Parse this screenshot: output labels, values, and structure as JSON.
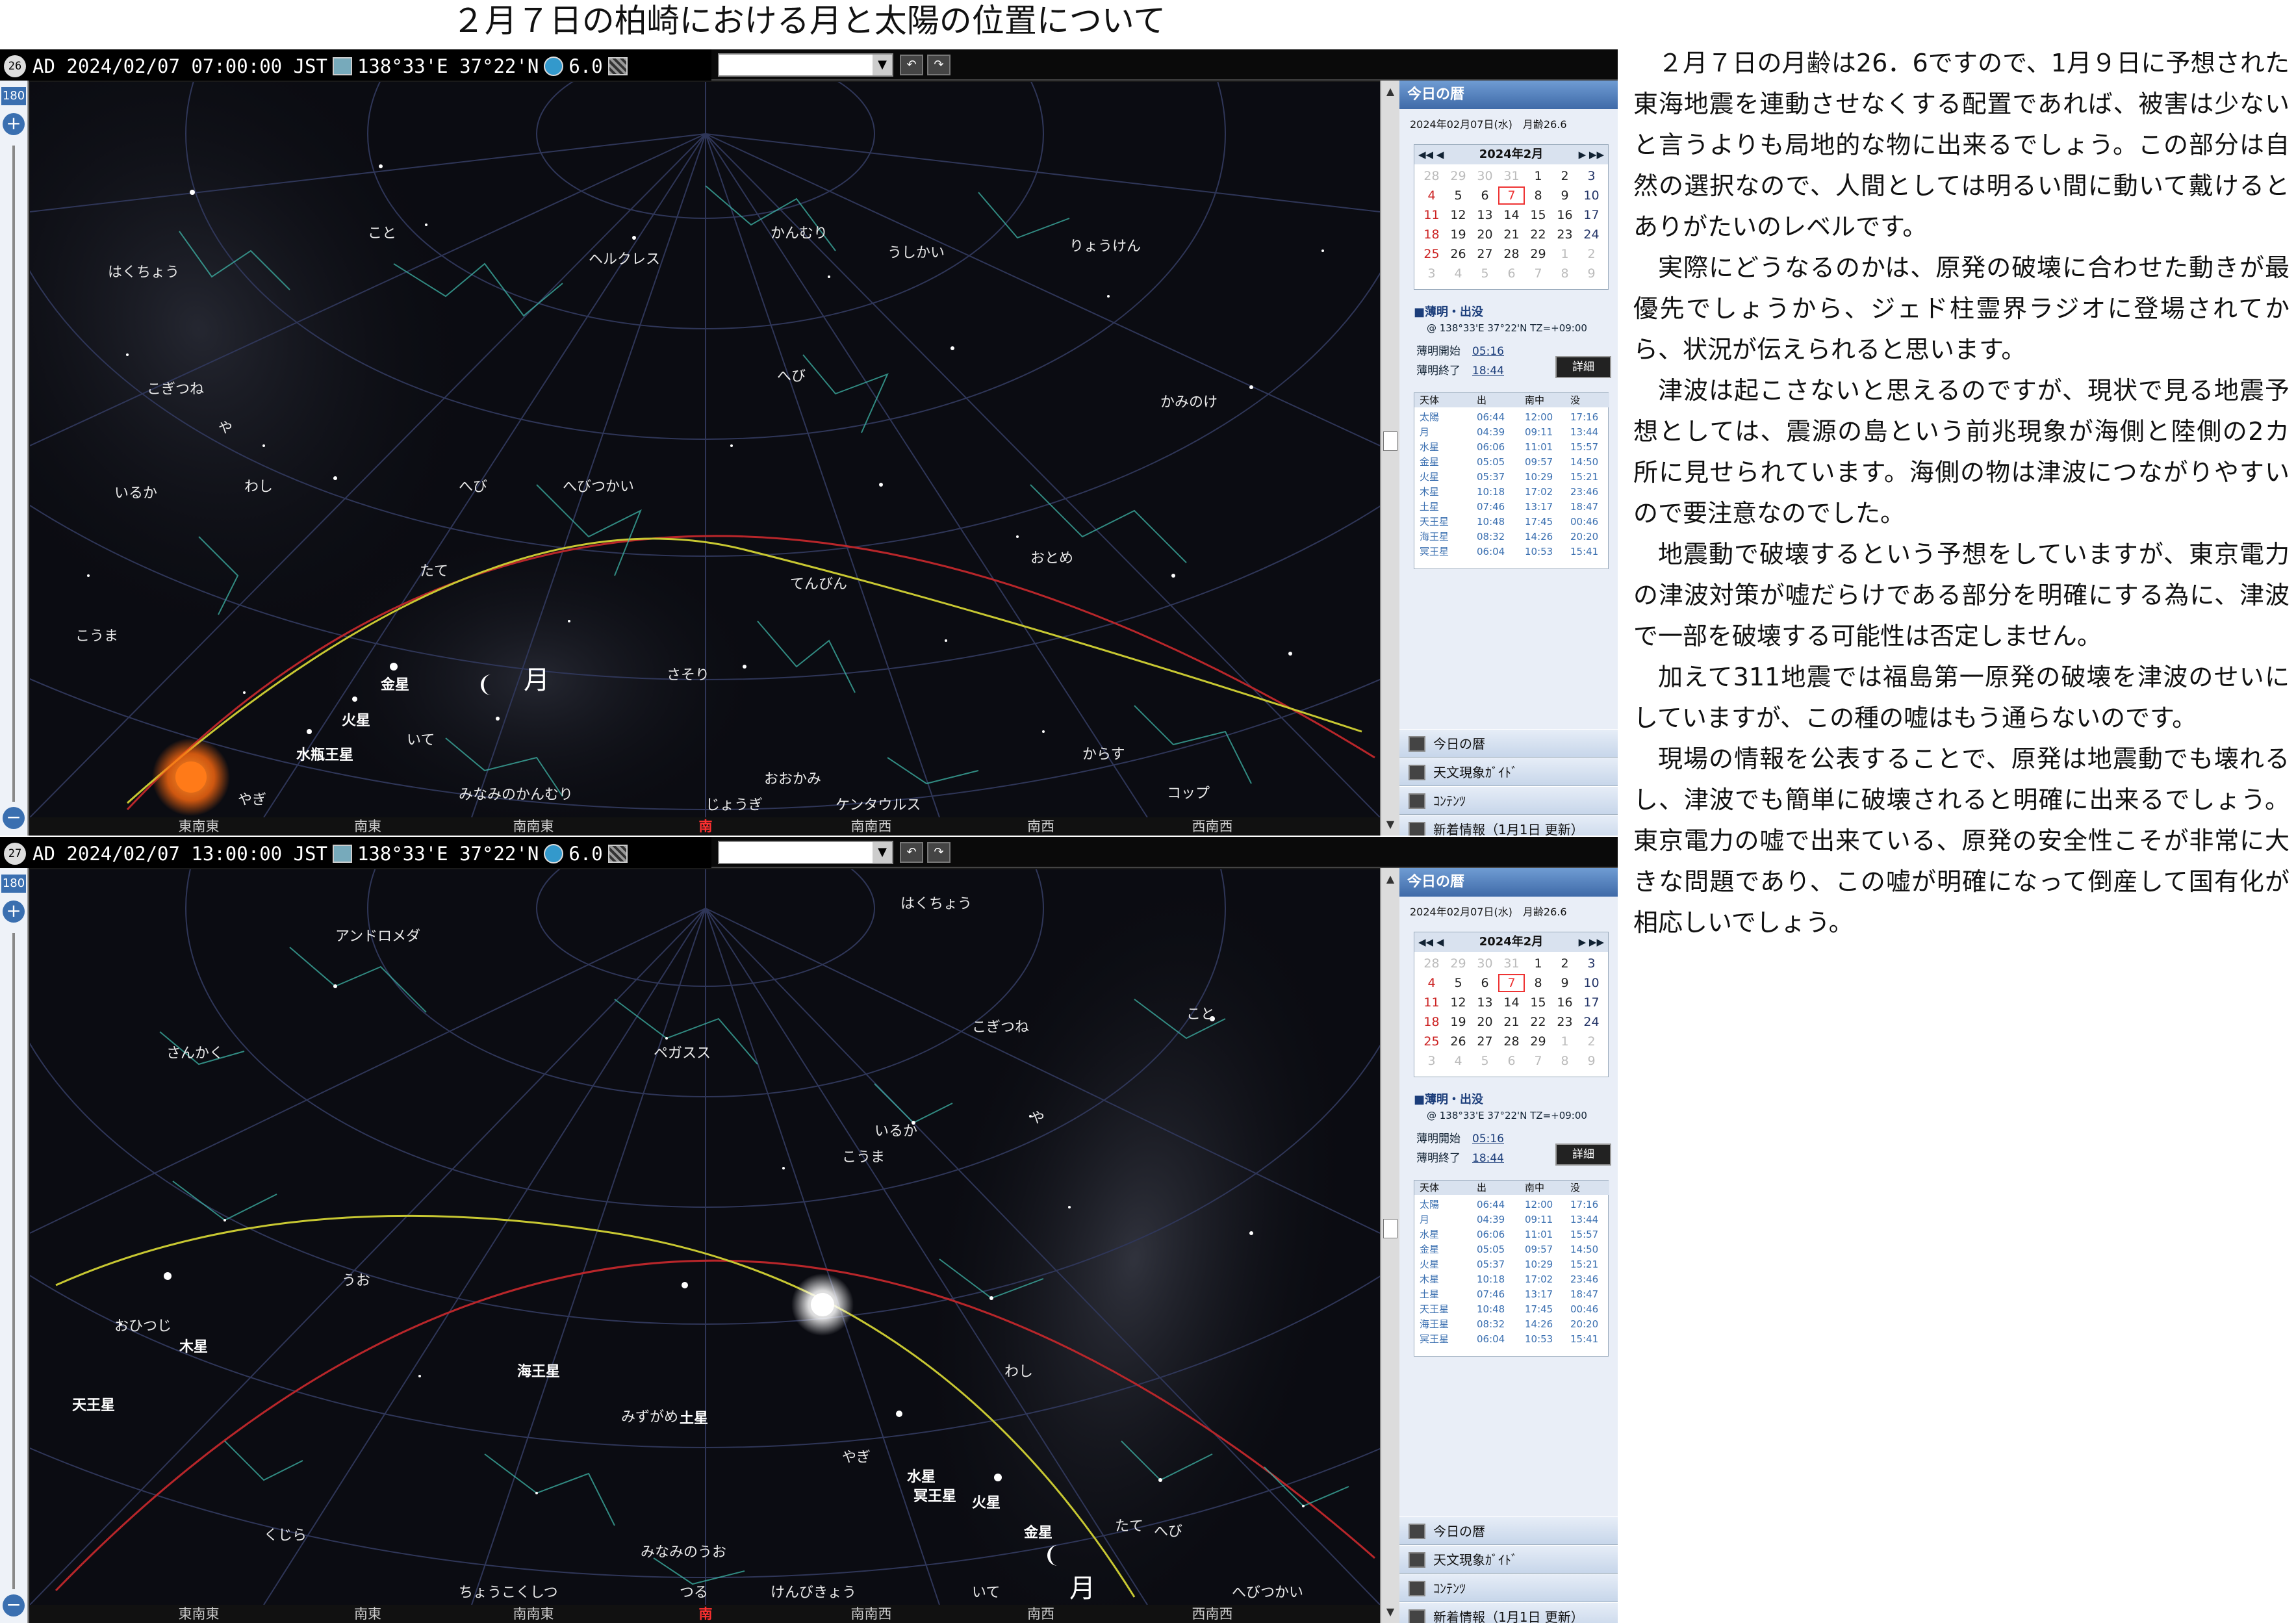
{
  "page_title": "２月７日の柏崎における月と太陽の位置について",
  "apps": [
    {
      "circle_icon_label": "26",
      "status_text": "AD 2024/02/07 07:00:00 JST",
      "location_text": "138°33'E 37°22'N",
      "magnitude": "6.0",
      "zoom_label": "180",
      "directions": [
        "東南東",
        "南東",
        "南南東",
        "南",
        "南南西",
        "南西",
        "西南西"
      ],
      "sky_labels": [
        "こと",
        "はくちょう",
        "ヘルクレス",
        "かんむり",
        "うしかい",
        "りょうけん",
        "こぎつね",
        "や",
        "へび",
        "かみのけ",
        "へびつかい",
        "いるか",
        "わし",
        "へび",
        "たて",
        "てんびん",
        "おとめ",
        "こうま",
        "さそり",
        "金星",
        "月",
        "火星",
        "いて",
        "水瓶王星",
        "からす",
        "みなみのかんむり",
        "おおかみ",
        "やぎ",
        "じょうぎ",
        "ケンタウルス",
        "コップ"
      ]
    },
    {
      "circle_icon_label": "27",
      "status_text": "AD 2024/02/07 13:00:00 JST",
      "location_text": "138°33'E 37°22'N",
      "magnitude": "6.0",
      "zoom_label": "180",
      "directions": [
        "東南東",
        "南東",
        "南南東",
        "南",
        "南南西",
        "南西",
        "西南西"
      ],
      "sky_labels": [
        "はくちょう",
        "アンドロメダ",
        "こと",
        "さんかく",
        "こぎつね",
        "ペガスス",
        "や",
        "いるか",
        "こうま",
        "うお",
        "おひつじ",
        "海王星",
        "わし",
        "木星",
        "みずがめ",
        "土星",
        "天王星",
        "やぎ",
        "水星",
        "冥王星",
        "火星",
        "たて",
        "へび",
        "くじら",
        "みなみのうお",
        "金星",
        "ちょうこくしつ",
        "けんびきょう",
        "いて",
        "へびつかい",
        "つる",
        "月"
      ]
    }
  ],
  "panel": {
    "header": "今日の暦",
    "date_line": "2024年02月07日(水)　月齢26.6",
    "calendar_title": "2024年2月",
    "calendar_nav_prev": "◀◀ ◀",
    "calendar_nav_next": "▶ ▶▶",
    "calendar_rows": [
      [
        "28",
        "29",
        "30",
        "31",
        "1",
        "2",
        "3"
      ],
      [
        "4",
        "5",
        "6",
        "7",
        "8",
        "9",
        "10"
      ],
      [
        "11",
        "12",
        "13",
        "14",
        "15",
        "16",
        "17"
      ],
      [
        "18",
        "19",
        "20",
        "21",
        "22",
        "23",
        "24"
      ],
      [
        "25",
        "26",
        "27",
        "28",
        "29",
        "1",
        "2"
      ],
      [
        "3",
        "4",
        "5",
        "6",
        "7",
        "8",
        "9"
      ]
    ],
    "twilight_title": "■薄明・出没",
    "twilight_location": "@ 138°33'E 37°22'N TZ=+09:00",
    "twilight_start_label": "薄明開始",
    "twilight_start": "05:16",
    "twilight_end_label": "薄明終了",
    "twilight_end": "18:44",
    "detail_button": "詳細",
    "ephemeris_header": [
      "天体",
      "出",
      "南中",
      "没"
    ],
    "ephemeris_rows": [
      [
        "太陽",
        "06:44",
        "12:00",
        "17:16"
      ],
      [
        "月",
        "04:39",
        "09:11",
        "13:44"
      ],
      [
        "水星",
        "06:06",
        "11:01",
        "15:57"
      ],
      [
        "金星",
        "05:05",
        "09:57",
        "14:50"
      ],
      [
        "火星",
        "05:37",
        "10:29",
        "15:21"
      ],
      [
        "木星",
        "10:18",
        "17:02",
        "23:46"
      ],
      [
        "土星",
        "07:46",
        "13:17",
        "18:47"
      ],
      [
        "天王星",
        "10:48",
        "17:45",
        "00:46"
      ],
      [
        "海王星",
        "08:32",
        "14:26",
        "20:20"
      ],
      [
        "冥王星",
        "06:04",
        "10:53",
        "15:41"
      ]
    ],
    "links": [
      "今日の暦",
      "天文現象ｶﾞｲﾄﾞ",
      "ｺﾝﾃﾝﾂ",
      "新着情報（1月1日 更新）"
    ]
  },
  "article": [
    "２月７日の月齢は26．6ですので、1月９日に予想された東海地震を連動させなくする配置であれば、被害は少ないと言うよりも局地的な物に出来るでしょう。この部分は自然の選択なので、人間としては明るい間に動いて戴けるとありがたいのレベルです。",
    "実際にどうなるのかは、原発の破壊に合わせた動きが最優先でしょうから、ジェド柱霊界ラジオに登場されてから、状況が伝えられると思います。",
    "津波は起こさないと思えるのですが、現状で見る地震予想としては、震源の島という前兆現象が海側と陸側の2カ所に見せられています。海側の物は津波につながりやすいので要注意なのでした。",
    "地震動で破壊するという予想をしていますが、東京電力の津波対策が嘘だらけである部分を明確にする為に、津波で一部を破壊する可能性は否定しません。",
    "加えて311地震では福島第一原発の破壊を津波のせいにしていますが、この種の嘘はもう通らないのです。",
    "現場の情報を公表することで、原発は地震動でも壊れるし、津波でも簡単に破壊されると明確に出来るでしょう。東京電力の嘘で出来ている、原発の安全性こそが非常に大きな問題であり、この嘘が明確になって倒産して国有化が相応しいでしょう。"
  ],
  "colors": {
    "sky_background": "#0b0c12",
    "grid_line": "#2f3658",
    "ecliptic": "#c8c832",
    "equator": "#b8262a",
    "sun_morning": "#ff7a18",
    "sun_noon": "#ffffff",
    "south_marker": "#ff3030",
    "panel_header": "#3f6aa8"
  }
}
